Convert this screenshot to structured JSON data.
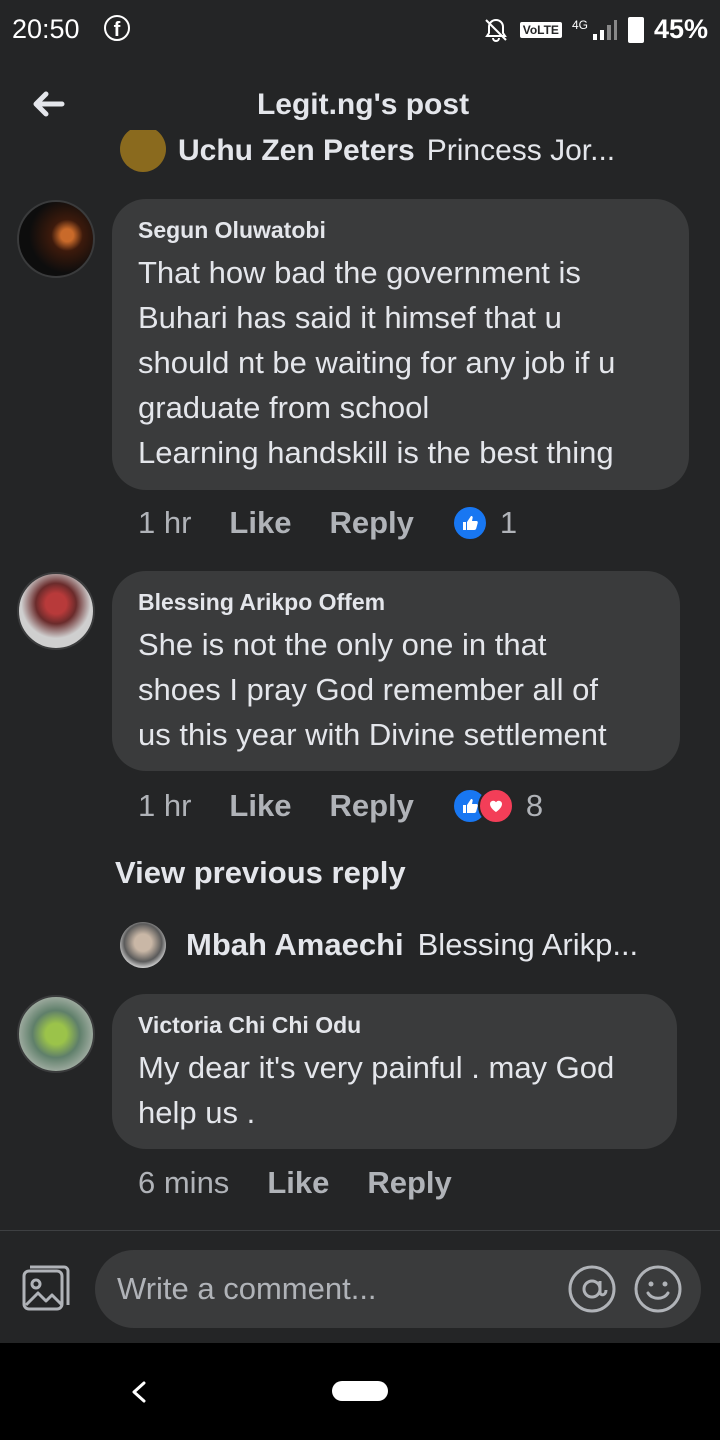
{
  "status_bar": {
    "time": "20:50",
    "network": "4G",
    "volte": "VoLTE",
    "battery": "45%"
  },
  "header": {
    "title": "Legit.ng's post"
  },
  "clipped_reply": {
    "name": "Uchu Zen Peters",
    "text": "Princess Jor..."
  },
  "comments": [
    {
      "author": "Segun Oluwatobi",
      "lines": [
        "That how bad the government is",
        "Buhari has said it himsef that u",
        "should nt be waiting for any job if u",
        "graduate from school",
        "Learning handskill is the best thing"
      ],
      "time": "1 hr",
      "like_label": "Like",
      "reply_label": "Reply",
      "reaction_count": "1"
    },
    {
      "author": "Blessing Arikpo Offem",
      "lines": [
        "She is not the only one in that",
        "shoes I pray God remember all of",
        "us this year with Divine settlement"
      ],
      "time": "1 hr",
      "like_label": "Like",
      "reply_label": "Reply",
      "reaction_count": "8"
    },
    {
      "author": "Victoria Chi Chi Odu",
      "lines": [
        "My dear it's very painful . may God",
        "help us ."
      ],
      "time": "6 mins",
      "like_label": "Like",
      "reply_label": "Reply"
    }
  ],
  "view_previous": "View previous reply",
  "reply_preview": {
    "name": "Mbah Amaechi",
    "text": "Blessing Arikp..."
  },
  "composer": {
    "placeholder": "Write a comment..."
  },
  "colors": {
    "background": "#242526",
    "bubble": "#3a3b3c",
    "like_blue": "#1877f2",
    "love_red": "#f33e58"
  }
}
